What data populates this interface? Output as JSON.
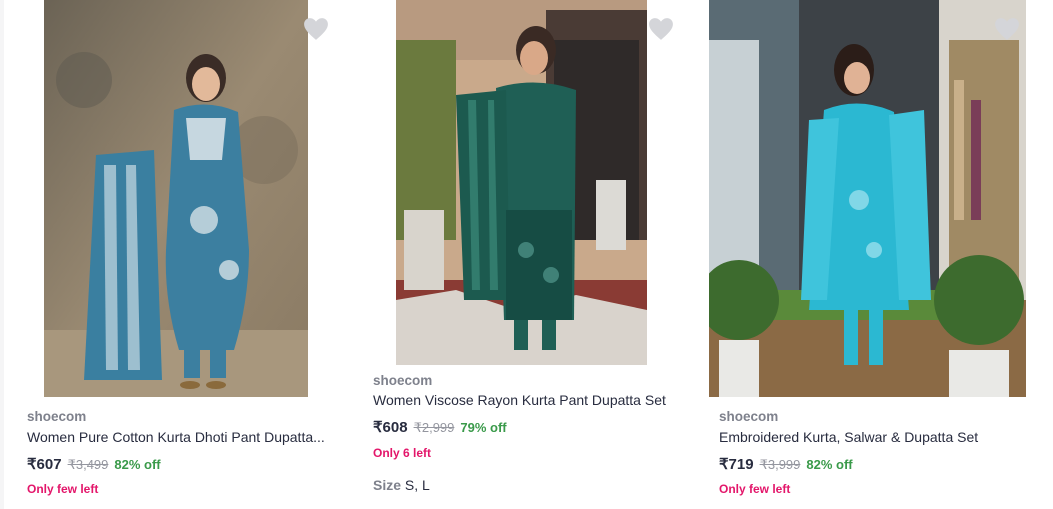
{
  "products": [
    {
      "brand": "shoecom",
      "title": "Women Pure Cotton Kurta Dhoti Pant Dupatta...",
      "price": "₹607",
      "mrp": "₹3,499",
      "discount": "82% off",
      "stock": "Only few left",
      "colors": {
        "backdrop": "#8e7d66",
        "outfit": "#3c7fa0"
      }
    },
    {
      "brand": "shoecom",
      "title": "Women Viscose Rayon Kurta Pant Dupatta Set",
      "price": "₹608",
      "mrp": "₹2,999",
      "discount": "79% off",
      "stock": "Only 6 left",
      "sizes_label": "Size",
      "sizes_value": "S, L",
      "colors": {
        "backdrop": "#c9a98b",
        "outfit": "#1f5f55"
      }
    },
    {
      "brand": "shoecom",
      "title": "Embroidered Kurta, Salwar & Dupatta Set",
      "price": "₹719",
      "mrp": "₹3,999",
      "discount": "82% off",
      "stock": "Only few left",
      "colors": {
        "backdrop": "#3d4247",
        "outfit": "#2bb8d2"
      }
    }
  ],
  "colors": {
    "discount": "#3a9a4a",
    "stock": "#e3166a",
    "brand": "#7e818c",
    "wishlist": "#d4d5d9"
  },
  "icons": {
    "wishlist": "heart-icon"
  }
}
